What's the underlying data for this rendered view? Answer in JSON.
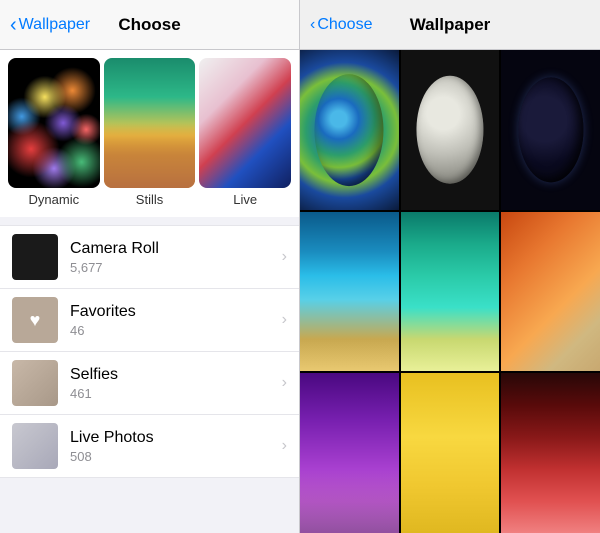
{
  "left": {
    "nav": {
      "back_label": "Wallpaper",
      "title": "Choose"
    },
    "previews": [
      {
        "id": "dynamic",
        "label": "Dynamic"
      },
      {
        "id": "stills",
        "label": "Stills"
      },
      {
        "id": "live",
        "label": "Live"
      }
    ],
    "list": [
      {
        "id": "camera-roll",
        "name": "Camera Roll",
        "count": "5,677"
      },
      {
        "id": "favorites",
        "name": "Favorites",
        "count": "46"
      },
      {
        "id": "selfies",
        "name": "Selfies",
        "count": "461"
      },
      {
        "id": "live-photos",
        "name": "Live Photos",
        "count": "508"
      }
    ]
  },
  "right": {
    "nav": {
      "back_label": "Choose",
      "title": "Wallpaper"
    },
    "grid": [
      {
        "id": "earth",
        "alt": "Earth"
      },
      {
        "id": "moon",
        "alt": "Moon"
      },
      {
        "id": "night-earth",
        "alt": "Night Earth"
      },
      {
        "id": "wave",
        "alt": "Ocean Wave"
      },
      {
        "id": "teal-wave",
        "alt": "Teal Wave"
      },
      {
        "id": "orange-abstract",
        "alt": "Orange Abstract"
      },
      {
        "id": "purple-flowers",
        "alt": "Purple Flowers"
      },
      {
        "id": "yellow",
        "alt": "Yellow"
      },
      {
        "id": "red-flowers",
        "alt": "Red Flowers"
      }
    ]
  }
}
